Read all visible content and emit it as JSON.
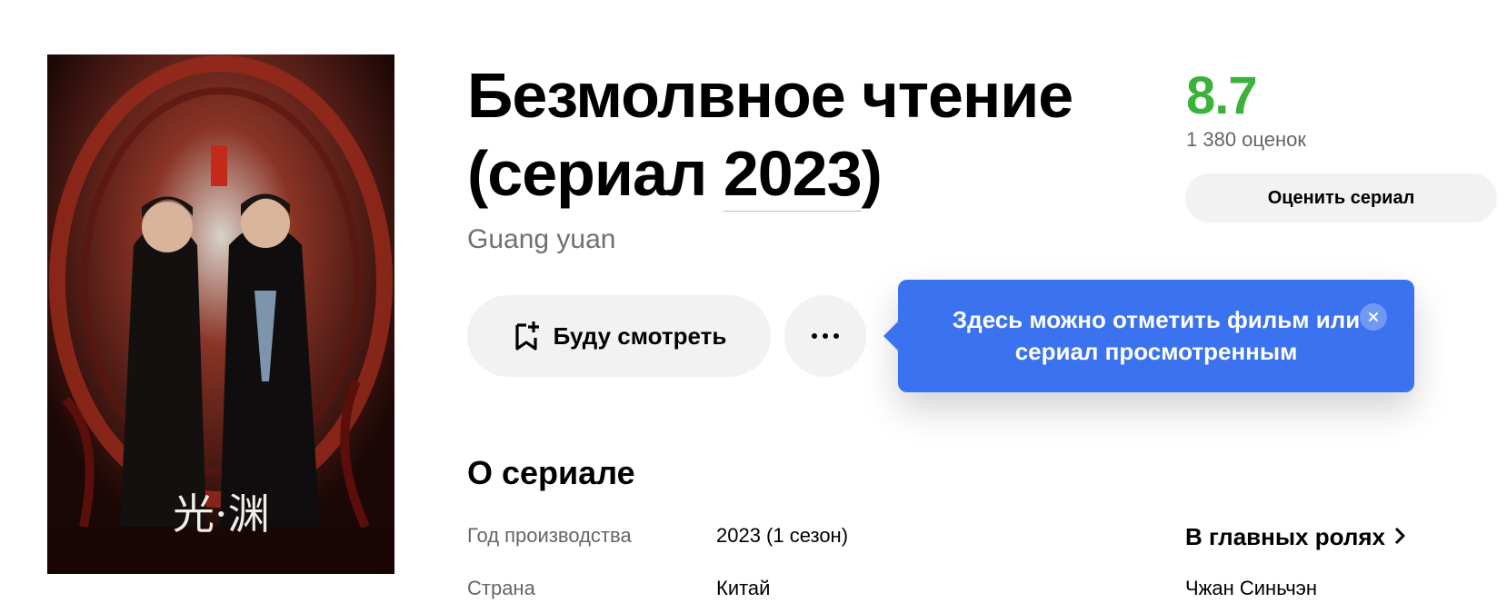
{
  "poster": {
    "caption": "光·渊"
  },
  "title": {
    "main": "Безмолвное чтение",
    "prefix": "(сериал ",
    "year": "2023",
    "suffix": ")"
  },
  "original_title": "Guang yuan",
  "rating": {
    "value": "8.7",
    "count": "1 380 оценок",
    "rate_label": "Оценить сериал",
    "color": "#3bb33b"
  },
  "actions": {
    "watch_label": "Буду смотреть",
    "more_icon": "more-dots-icon"
  },
  "tooltip": {
    "text": "Здесь можно отметить фильм или сериал просмотренным",
    "color": "#3a72f0"
  },
  "about": {
    "heading": "О сериале",
    "rows": [
      {
        "label": "Год производства",
        "value": "2023 (1 сезон)"
      },
      {
        "label": "Страна",
        "value": "Китай"
      }
    ]
  },
  "cast": {
    "heading": "В главных ролях",
    "items": [
      "Чжан Синьчэн"
    ]
  }
}
